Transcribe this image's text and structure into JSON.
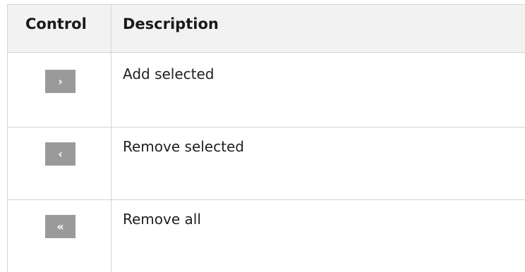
{
  "table": {
    "headers": {
      "control": "Control",
      "description": "Description"
    },
    "rows": [
      {
        "icon_glyph": "›",
        "icon_name": "chevron-right-icon",
        "description": "Add selected"
      },
      {
        "icon_glyph": "‹",
        "icon_name": "chevron-left-icon",
        "description": "Remove selected"
      },
      {
        "icon_glyph": "«",
        "icon_name": "double-chevron-left-icon",
        "description": "Remove all"
      }
    ]
  }
}
